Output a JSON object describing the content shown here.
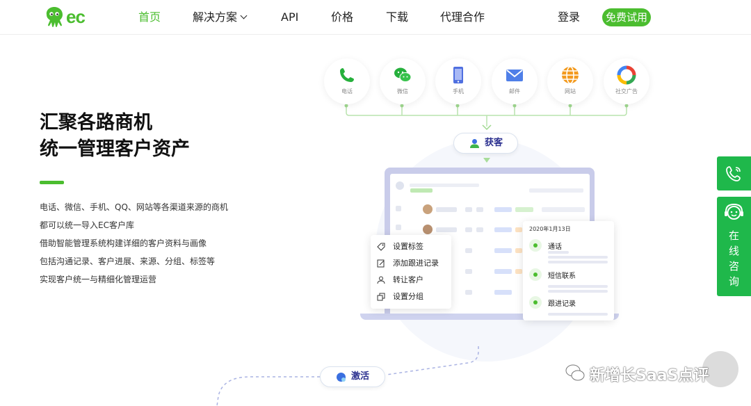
{
  "brand": {
    "logo_text": "ec",
    "accent": "#4bbd2f"
  },
  "nav": {
    "items": [
      {
        "label": "首页",
        "active": true
      },
      {
        "label": "解决方案",
        "dropdown": true
      },
      {
        "label": "API"
      },
      {
        "label": "价格"
      },
      {
        "label": "下载"
      },
      {
        "label": "代理合作"
      }
    ],
    "login_label": "登录",
    "trial_label": "免费试用"
  },
  "hero": {
    "headline_line1": "汇聚各路商机",
    "headline_line2": "统一管理客户资产",
    "description": [
      "电话、微信、手机、QQ、网站等各渠道来源的商机",
      "都可以统一导入EC客户库",
      "借助智能管理系统构建详细的客户资料与画像",
      "包括沟通记录、客户进展、来源、分组、标签等",
      "实现客户统一与精细化管理运营"
    ]
  },
  "channels": [
    {
      "label": "电话",
      "icon": "phone-icon"
    },
    {
      "label": "微信",
      "icon": "wechat-icon"
    },
    {
      "label": "手机",
      "icon": "mobile-icon"
    },
    {
      "label": "邮件",
      "icon": "mail-icon"
    },
    {
      "label": "网站",
      "icon": "globe-icon"
    },
    {
      "label": "社交广告",
      "icon": "social-ad-icon"
    }
  ],
  "acquire_label": "获客",
  "activate_label": "激活",
  "context_menu": [
    {
      "label": "设置标签",
      "icon": "tag-icon"
    },
    {
      "label": "添加跟进记录",
      "icon": "edit-note-icon"
    },
    {
      "label": "转让客户",
      "icon": "user-icon"
    },
    {
      "label": "设置分组",
      "icon": "group-icon"
    }
  ],
  "timeline": {
    "date": "2020年1月13日",
    "items": [
      {
        "label": "通话",
        "icon": "phone-icon"
      },
      {
        "label": "短信联系",
        "icon": "sms-icon"
      },
      {
        "label": "跟进记录",
        "icon": "pen-icon"
      }
    ]
  },
  "side_buttons": {
    "consult_label": "在线咨询"
  },
  "watermark": "新增长SaaS点评"
}
